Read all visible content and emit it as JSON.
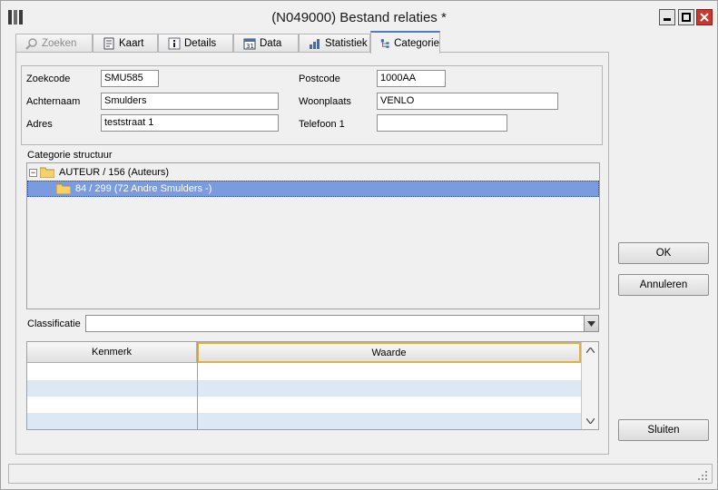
{
  "window": {
    "title": "(N049000) Bestand relaties *",
    "controls": {
      "minimize": "minimize",
      "maximize": "maximize",
      "close": "close"
    }
  },
  "tabs": [
    {
      "label": "Zoeken",
      "icon": "magnifier-icon",
      "state": "disabled"
    },
    {
      "label": "Kaart",
      "icon": "card-icon",
      "state": "normal"
    },
    {
      "label": "Details",
      "icon": "info-icon",
      "state": "normal"
    },
    {
      "label": "Data",
      "icon": "calendar-icon",
      "state": "normal"
    },
    {
      "label": "Statistiek",
      "icon": "bar-chart-icon",
      "state": "normal"
    },
    {
      "label": "Categorie",
      "icon": "tree-icon",
      "state": "active"
    }
  ],
  "form": {
    "zoekcode": {
      "label": "Zoekcode",
      "value": "SMU585"
    },
    "achternaam": {
      "label": "Achternaam",
      "value": "Smulders"
    },
    "adres": {
      "label": "Adres",
      "value": "teststraat 1"
    },
    "postcode": {
      "label": "Postcode",
      "value": "1000AA"
    },
    "woonplaats": {
      "label": "Woonplaats",
      "value": "VENLO"
    },
    "telefoon": {
      "label": "Telefoon 1",
      "value": ""
    }
  },
  "tree": {
    "label": "Categorie structuur",
    "nodes": [
      {
        "text": "AUTEUR / 156 (Auteurs)",
        "expander": "−",
        "selected": false
      },
      {
        "text": "84 / 299 (72 Andre Smulders -)",
        "selected": true
      }
    ]
  },
  "classificatie": {
    "label": "Classificatie",
    "value": ""
  },
  "grid": {
    "columns": [
      "Kenmerk",
      "Waarde"
    ],
    "rows": [
      {
        "kenmerk": "",
        "waarde": ""
      },
      {
        "kenmerk": "",
        "waarde": ""
      },
      {
        "kenmerk": "",
        "waarde": ""
      },
      {
        "kenmerk": "",
        "waarde": ""
      }
    ]
  },
  "buttons": {
    "ok": "OK",
    "cancel": "Annuleren",
    "close": "Sluiten"
  },
  "colors": {
    "selection": "#7b9be0",
    "tab_accent": "#4a7fc7",
    "alt_row": "#dce9f5",
    "close_button": "#c8382f"
  }
}
